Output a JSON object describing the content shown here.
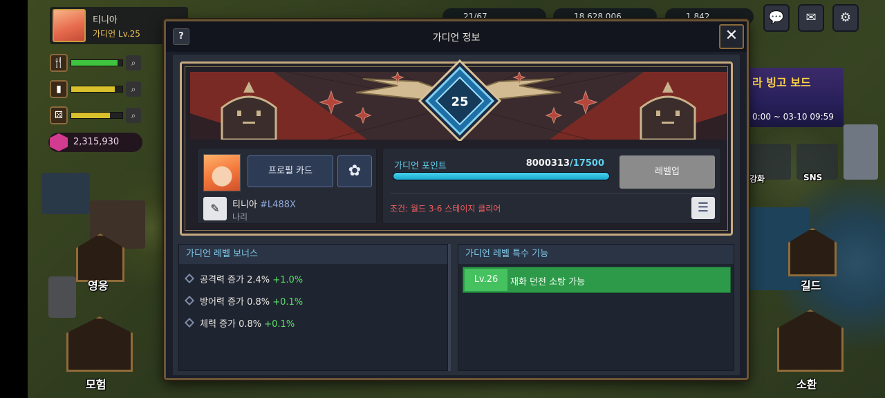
{
  "hud": {
    "player_name": "티니아",
    "player_level": "가디언 Lv.25",
    "gems": "2,315,930",
    "resources": [
      "21/67",
      "18,628,006",
      "1,842"
    ],
    "stat_icons": [
      "fork-knife-icon",
      "cup-icon",
      "dice-icon"
    ],
    "stat_fill": [
      0.9,
      0.85,
      0.75
    ]
  },
  "side_menu": {
    "hero": "영웅",
    "adventure": "모험",
    "guild": "길드",
    "summon": "소환",
    "enhance": "강화",
    "sns": "SNS"
  },
  "event": {
    "title": "라 빙고 보드",
    "time": "0:00 ~ 03-10 09:59"
  },
  "dialog": {
    "help": "?",
    "title": "가디언 정보",
    "close": "✕",
    "badge_level": "25",
    "profile_card": "프로필 카드",
    "nickname": "티니아",
    "tag": "#L488X",
    "subtitle": "나리",
    "points_label": "가디언 포인트",
    "points_current": "8000313",
    "points_max": "/17500",
    "points_fill": 1.0,
    "levelup": "레벨업",
    "condition": "조건: 월드 3-6 스테이지 클리어",
    "bonus_title": "가디언 레벨 보너스",
    "bonuses": [
      {
        "text": "공격력 증가 2.4% ",
        "plus": "+1.0%"
      },
      {
        "text": "방어력 증가 0.8% ",
        "plus": "+0.1%"
      },
      {
        "text": "체력 증가 0.8% ",
        "plus": "+0.1%"
      }
    ],
    "special_title": "가디언 레벨 특수 기능",
    "special": {
      "lv": "Lv.26",
      "text": "재화 던전 소탕 가능"
    }
  },
  "colors": {
    "accent_cyan": "#5fd1ee",
    "condition_red": "#ef5f5f",
    "bonus_green": "#5ee06a",
    "special_green": "#2d9a4a",
    "frame_gold": "#c7ab7f"
  }
}
